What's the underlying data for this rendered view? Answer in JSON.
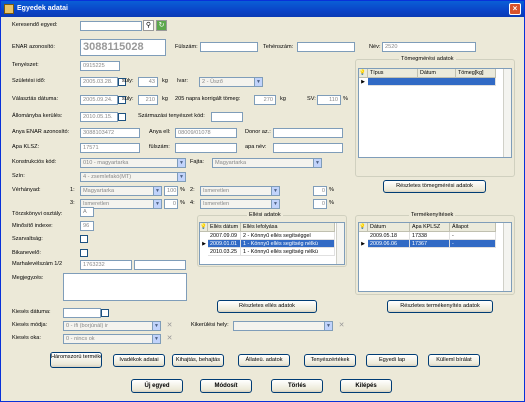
{
  "window": {
    "title": "Egyedek adatai",
    "close_label": "×"
  },
  "form": {
    "search_label": "Keresendő egyed:",
    "search_value": "",
    "enar_label": "ENAR azonosító:",
    "enar_value": "3088115028",
    "fulszam_label": "Fülszám:",
    "fulszam_value": "",
    "tehenszam_label": "Tehénszám:",
    "tehenszam_value": "",
    "nev_label": "Név:",
    "nev_value": "2520",
    "tenyeszet_label": "Tenyészet:",
    "tenyeszet_value": "0915225",
    "szuletes_label": "Születési idő:",
    "szuletes_value": "2005.03.28.",
    "suly_label": "súly:",
    "suly1_value": "43",
    "suly_unit": "kg",
    "ivar_label": "Ivar:",
    "ivar_value": "2 - Üsző",
    "valasztas_label": "Választás dátuma:",
    "valasztas_value": "2005.09.24.",
    "suly2_value": "210",
    "korrigalt_label": "205 napra korrigált tömeg:",
    "korrigalt_value": "270",
    "korrigalt_unit": "kg",
    "sv_label": "SV:",
    "sv_value": "110",
    "sv_unit": "%",
    "allomany_label": "Állományba kerülés:",
    "allomany_value": "2010.05.15.",
    "szarmazasi_label": "Származási tenyészet kód:",
    "szarmazasi_value": "",
    "anya_enar_label": "Anya ENAR azonosító:",
    "anya_enar_value": "3088103472",
    "anya_ell_label": "Anya ell:",
    "anya_ell_value": "08009/01078",
    "donor_label": "Donor az.:",
    "donor_value": "",
    "apa_klsz_label": "Apa KLSZ:",
    "apa_klsz_value": "17571",
    "fulszam2_label": "fülszám:",
    "fulszam2_value": "",
    "apa_nev_label": "apa név:",
    "apa_nev_value": "",
    "konstrukcio_label": "Konstrukciós kód:",
    "konstrukcio_value": "010 - magyartarka",
    "fajta_label": "Fajta:",
    "fajta_value": "Magyartarka",
    "szin_label": "Szín:",
    "szin_value": "4 - zsemlefakó(MT)",
    "verhanyad_label": "Vérhányad:",
    "ver1_num": "1:",
    "ver1_value": "Magyartarka",
    "ver1_pct": "100",
    "ver2_num": "2:",
    "ver2_value": "Ismeretlen",
    "ver2_pct": "0",
    "ver3_num": "3:",
    "ver3_value": "Ismeretlen",
    "ver3_pct": "0",
    "ver4_num": "4:",
    "ver4_value": "Ismeretlen",
    "ver4_pct": "0",
    "pct_unit": "%",
    "torzskonyvi_label": "Törzskönyvi osztály:",
    "torzskonyvi_value": "A",
    "minosito_label": "Minősítő indexe:",
    "minosito_value": "96",
    "szarvaltsag_label": "Szarvaltság:",
    "bikanevelo_label": "Bikanevelő:",
    "marhalevel_label": "Marhalevélszám 1/2",
    "marhalevel_value": "1763232",
    "megjegyzes_label": "Megjegyzés:",
    "kieses_datum_label": "Kiesés dátuma:",
    "kieses_modja_label": "Kiesés módja:",
    "kieses_modja_value": "0 - ifi (borjúnál) ir",
    "kieses_oka_label": "Kiesés oka:",
    "kieses_oka_value": "0 - nincs ok",
    "kikerulesi_label": "Kikerülési hely:"
  },
  "tomeg": {
    "title": "Tömegmérési adatok",
    "headers": [
      "Típus",
      "Dátum",
      "Tömeg[kg]"
    ],
    "button": "Részletes tömegmérési adatok"
  },
  "elles": {
    "title": "Ellési adatok",
    "headers": [
      "Ellés dátum",
      "Ellés lefolyása"
    ],
    "rows": [
      [
        "2007.09.09",
        "2 - Könnyű ellés segítséggel"
      ],
      [
        "2009.01.01",
        "1 - Könnyű ellés segítség nélkü"
      ],
      [
        "2010.03.25",
        "1 - Könnyű ellés segítség nélkü"
      ]
    ],
    "button": "Részletes ellés adatok"
  },
  "termek": {
    "title": "Termékenyítések",
    "headers": [
      "Dátum",
      "Apa KPLSZ",
      "Állapot"
    ],
    "rows": [
      [
        "2009.05.18",
        "17338",
        "-"
      ],
      [
        "2009.06.06",
        "17367",
        "-"
      ]
    ],
    "button": "Részletes termékenyítés adatok"
  },
  "actions": {
    "haromszori": "Háromszorú termékenyítések",
    "ivadekok": "Ivadékok adatai",
    "kihajtas": "Kihajtás, behajtás",
    "allateu": "Állateü. adatok",
    "tenyeszertekek": "Tenyészértékek",
    "egyedi_lap": "Egyedi lap",
    "kulleme": "Külleml bírálat"
  },
  "bottom": {
    "uj": "Új egyed",
    "modosit": "Módosít",
    "torles": "Törlés",
    "kilepes": "Kilépés"
  }
}
